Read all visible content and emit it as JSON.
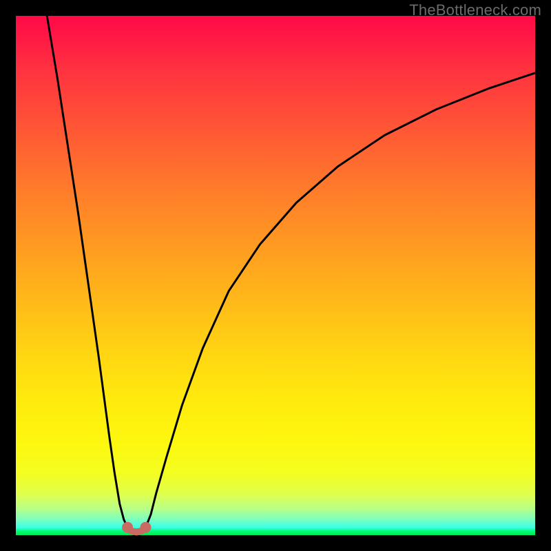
{
  "attribution": "TheBottleneck.com",
  "colors": {
    "frame": "#000000",
    "curve": "#000000",
    "marker": "#c86b62",
    "gradient_top": "#ff0a46",
    "gradient_bottom": "#00e852"
  },
  "chart_data": {
    "type": "line",
    "title": "",
    "xlabel": "",
    "ylabel": "",
    "xlim": [
      0,
      100
    ],
    "ylim": [
      0,
      100
    ],
    "grid": false,
    "legend": false,
    "note": "No axis ticks or numeric labels are shown in the image; x/y scaled 0–100. Curve values estimated from pixel positions. y=0 is bottom (green), y=100 is top (red).",
    "series": [
      {
        "name": "left-branch",
        "x": [
          6,
          8,
          10,
          12,
          14,
          16,
          18,
          19,
          20,
          20.8,
          21.5
        ],
        "y": [
          100,
          88,
          75,
          62,
          48,
          34,
          19,
          12,
          6,
          3,
          1.5
        ]
      },
      {
        "name": "right-branch",
        "x": [
          25,
          26,
          27,
          29,
          32,
          36,
          41,
          47,
          54,
          62,
          71,
          81,
          91,
          100
        ],
        "y": [
          1.5,
          4,
          8,
          15,
          25,
          36,
          47,
          56,
          64,
          71,
          77,
          82,
          86,
          89
        ]
      }
    ],
    "markers": [
      {
        "name": "trough-left",
        "x": 21.5,
        "y": 1.5
      },
      {
        "name": "trough-right",
        "x": 25.0,
        "y": 1.5
      }
    ],
    "trough_connector": {
      "x": [
        21.5,
        22.2,
        23.2,
        24.2,
        25.0
      ],
      "y": [
        1.5,
        0.8,
        0.6,
        0.8,
        1.5
      ]
    }
  }
}
